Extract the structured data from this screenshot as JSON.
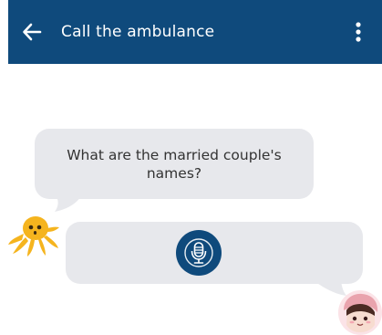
{
  "header": {
    "title": "Call the ambulance",
    "background": "#0f4a7c"
  },
  "chat": {
    "question": "What are the married couple's names?",
    "answer_type": "voice-recording",
    "bubble_color": "#e7e8ec"
  },
  "icons": {
    "back": "arrow-left-icon",
    "menu": "more-vertical-icon",
    "mic": "microphone-icon",
    "bot_avatar": "octopus-icon",
    "user_avatar": "girl-avatar-icon"
  }
}
